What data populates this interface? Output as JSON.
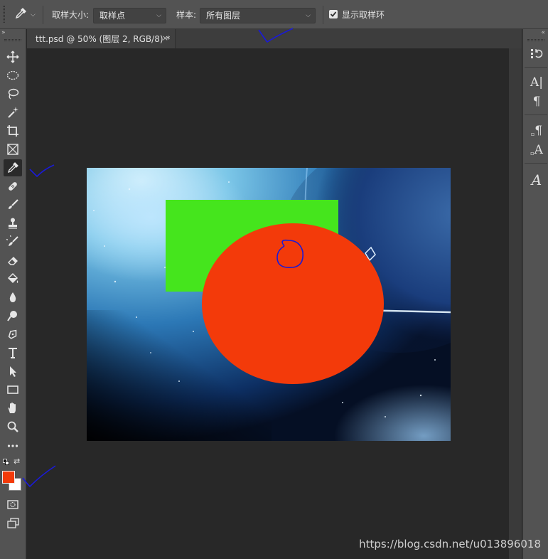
{
  "options_bar": {
    "tool_icon": "eyedropper-icon",
    "sample_size_label": "取样大小:",
    "sample_size_value": "取样点",
    "sample_label": "样本:",
    "sample_value": "所有图层",
    "show_ring_label": "显示取样环",
    "show_ring_checked": true
  },
  "document_tab": {
    "title": "ttt.psd @ 50% (图层 2, RGB/8) *",
    "close": "×"
  },
  "toolbar": {
    "tools": [
      "move-tool",
      "marquee-tool",
      "lasso-tool",
      "magic-wand-tool",
      "crop-tool",
      "frame-tool",
      "eyedropper-tool",
      "healing-brush-tool",
      "brush-tool",
      "clone-stamp-tool",
      "history-brush-tool",
      "eraser-tool",
      "paint-bucket-tool",
      "blur-tool",
      "dodge-tool",
      "pen-tool",
      "type-tool",
      "path-selection-tool",
      "rectangle-tool",
      "hand-tool",
      "zoom-tool",
      "more-tools"
    ],
    "active_tool": "eyedropper-tool",
    "foreground_color": "#f33a0a",
    "background_color": "#ffffff"
  },
  "canvas": {
    "green_rectangle_color": "#45e51d",
    "red_ellipse_color": "#f33a0a"
  },
  "right_panel": {
    "items": [
      "history-icon",
      "character-icon",
      "paragraph-icon",
      "paragraph-styles-icon",
      "character-styles-icon",
      "glyphs-icon"
    ]
  },
  "watermark": "https://blog.csdn.net/u013896018"
}
